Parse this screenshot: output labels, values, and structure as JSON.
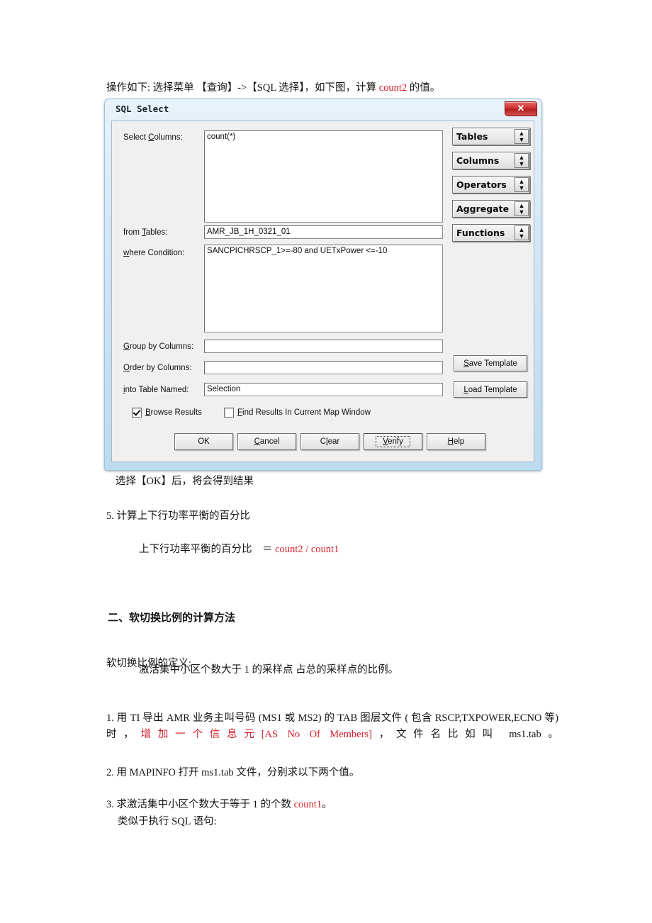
{
  "document": {
    "intro_prefix": "操作如下: 选择菜单 【查询】->【SQL 选择】，如下图，计算 ",
    "intro_red": "count2",
    "intro_suffix": " 的值。",
    "after_dialog": "选择【OK】后，将会得到结果",
    "step5": "5. 计算上下行功率平衡的百分比",
    "formula_label": "上下行功率平衡的百分比　＝",
    "formula_value": "count2 / count1",
    "section2_title": "二、软切换比例的计算方法",
    "definition_title": "软切换比例的定义:",
    "definition_body": "激活集中小区个数大于 1 的采样点 占总的采样点的比例。",
    "para1_a": "1. 用 TI 导出 AMR 业务主叫号码 (MS1 或 MS2) 的 TAB 图层文件 ( 包含 RSCP,TXPOWER,ECNO 等)时，",
    "para1_red": "增加一个信息元[AS No Of Members]",
    "para1_b": "，文件名比如叫 ms1.tab。",
    "para2": "2. 用 MAPINFO 打开 ms1.tab 文件，分别求以下两个值。",
    "para3_a": "3. 求激活集中小区个数大于等于 1 的个数 ",
    "para3_red": "count1",
    "para3_b": "。",
    "para3_sub": "类似于执行 SQL 语句:"
  },
  "dialog": {
    "title": "SQL Select",
    "close_label": "✕",
    "fields": [
      {
        "label_pre": "Select ",
        "label_key": "C",
        "label_post": "olumns:",
        "value": "count(*)"
      },
      {
        "label_pre": "from ",
        "label_key": "T",
        "label_post": "ables:",
        "value": "AMR_JB_1H_0321_01"
      },
      {
        "label_pre": "",
        "label_key": "w",
        "label_post": "here Condition:",
        "value": "SANCPICHRSCP_1>=-80 and UETxPower <=-10"
      },
      {
        "label_pre": "",
        "label_key": "G",
        "label_post": "roup by Columns:",
        "value": ""
      },
      {
        "label_pre": "",
        "label_key": "O",
        "label_post": "rder by Columns:",
        "value": ""
      },
      {
        "label_pre": "",
        "label_key": "i",
        "label_post": "nto Table Named:",
        "value": "Selection"
      }
    ],
    "combos": [
      {
        "label": "Tables"
      },
      {
        "label": "Columns"
      },
      {
        "label": "Operators"
      },
      {
        "label": "Aggregate"
      },
      {
        "label": "Functions"
      }
    ],
    "templates": [
      {
        "pre": "",
        "key": "S",
        "post": "ave Template"
      },
      {
        "pre": "",
        "key": "L",
        "post": "oad Template"
      }
    ],
    "checkboxes": [
      {
        "pre": "",
        "key": "B",
        "post": "rowse Results",
        "checked": true
      },
      {
        "pre": "",
        "key": "F",
        "post": "ind Results In Current Map Window",
        "checked": false
      }
    ],
    "buttons": [
      {
        "pre": "OK",
        "key": "",
        "post": "",
        "focused": false
      },
      {
        "pre": "",
        "key": "C",
        "post": "ancel",
        "focused": false
      },
      {
        "pre": "C",
        "key": "l",
        "post": "ear",
        "focused": false
      },
      {
        "pre": "",
        "key": "V",
        "post": "erify",
        "focused": true
      },
      {
        "pre": "",
        "key": "H",
        "post": "elp",
        "focused": false
      }
    ]
  },
  "colors": {
    "accent_red": "#d4202c",
    "title_bar": "#cfe4f4",
    "close_button": "#cf3030"
  }
}
